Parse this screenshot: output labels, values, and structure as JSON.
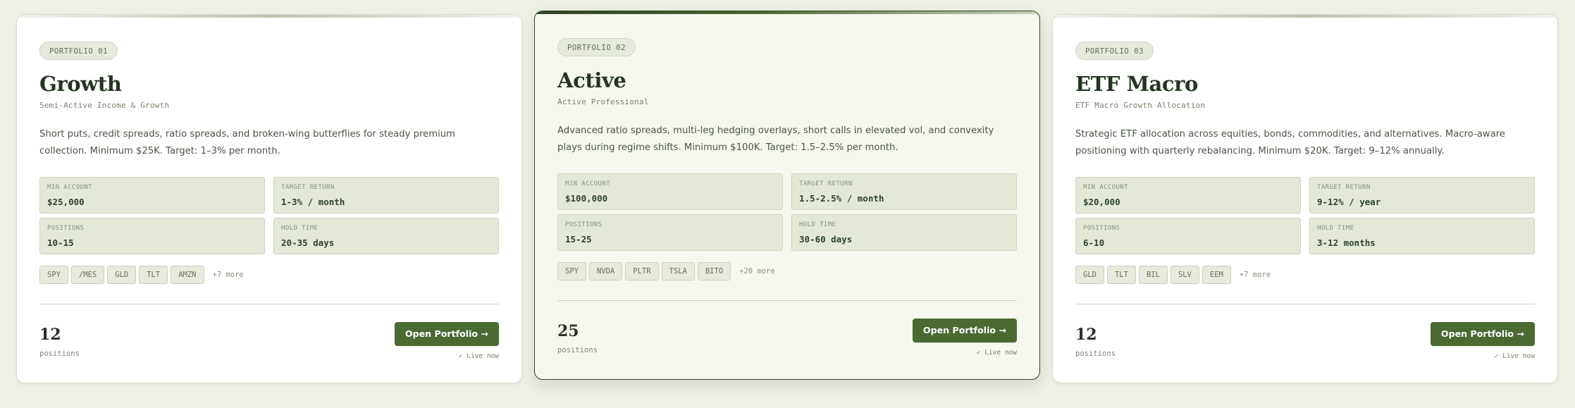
{
  "portfolios": [
    {
      "badge": "PORTFOLIO 01",
      "title": "Growth",
      "subtitle": "Semi-Active Income & Growth",
      "description": "Short puts, credit spreads, ratio spreads, and broken-wing butterflies for steady premium collection. Minimum $25K. Target: 1–3% per month.",
      "stats": [
        {
          "label": "MIN ACCOUNT",
          "value": "$25,000"
        },
        {
          "label": "TARGET RETURN",
          "value": "1-3% / month"
        },
        {
          "label": "POSITIONS",
          "value": "10-15"
        },
        {
          "label": "HOLD TIME",
          "value": "20-35 days"
        }
      ],
      "tickers": [
        "SPY",
        "/MES",
        "GLD",
        "TLT",
        "AMZN"
      ],
      "more": "+7 more",
      "count": "12",
      "count_label": "positions",
      "button": "Open Portfolio →",
      "status": "✓ Live now",
      "featured": false
    },
    {
      "badge": "PORTFOLIO 02",
      "title": "Active",
      "subtitle": "Active Professional",
      "description": "Advanced ratio spreads, multi-leg hedging overlays, short calls in elevated vol, and convexity plays during regime shifts. Minimum $100K. Target: 1.5–2.5% per month.",
      "stats": [
        {
          "label": "MIN ACCOUNT",
          "value": "$100,000"
        },
        {
          "label": "TARGET RETURN",
          "value": "1.5-2.5% / month"
        },
        {
          "label": "POSITIONS",
          "value": "15-25"
        },
        {
          "label": "HOLD TIME",
          "value": "30-60 days"
        }
      ],
      "tickers": [
        "SPY",
        "NVDA",
        "PLTR",
        "TSLA",
        "BITO"
      ],
      "more": "+20 more",
      "count": "25",
      "count_label": "positions",
      "button": "Open Portfolio →",
      "status": "✓ Live now",
      "featured": true
    },
    {
      "badge": "PORTFOLIO 03",
      "title": "ETF Macro",
      "subtitle": "ETF Macro Growth Allocation",
      "description": "Strategic ETF allocation across equities, bonds, commodities, and alternatives. Macro-aware positioning with quarterly rebalancing. Minimum $20K. Target: 9–12% annually.",
      "stats": [
        {
          "label": "MIN ACCOUNT",
          "value": "$20,000"
        },
        {
          "label": "TARGET RETURN",
          "value": "9-12% / year"
        },
        {
          "label": "POSITIONS",
          "value": "6-10"
        },
        {
          "label": "HOLD TIME",
          "value": "3-12 months"
        }
      ],
      "tickers": [
        "GLD",
        "TLT",
        "BIL",
        "SLV",
        "EEM"
      ],
      "more": "+7 more",
      "count": "12",
      "count_label": "positions",
      "button": "Open Portfolio →",
      "status": "✓ Live now",
      "featured": false
    }
  ],
  "colors": {
    "page_background": "#eef0e6",
    "card_background": "#ffffff",
    "featured_background": "#f6f8ef",
    "primary": "#4b6a32",
    "heading": "#243522"
  }
}
